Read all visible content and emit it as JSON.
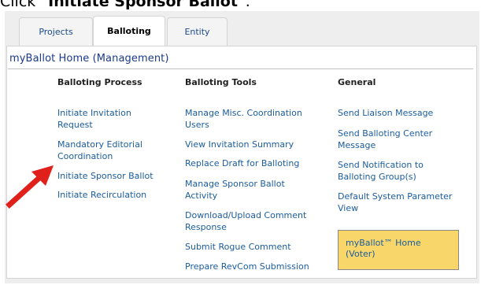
{
  "instruction": {
    "prefix": "Click “",
    "target": "Initiate Sponsor Ballot",
    "suffix": "”."
  },
  "tabs": [
    {
      "label": "Projects",
      "active": false
    },
    {
      "label": "Balloting",
      "active": true
    },
    {
      "label": "Entity",
      "active": false
    }
  ],
  "page_title": "myBallot Home (Management)",
  "columns": {
    "process": {
      "heading": "Balloting Process",
      "links": [
        "Initiate Invitation Request",
        "Mandatory Editorial Coordination",
        "Initiate Sponsor Ballot",
        "Initiate Recirculation"
      ]
    },
    "tools": {
      "heading": "Balloting Tools",
      "links": [
        "Manage Misc. Coordination Users",
        "View Invitation Summary",
        "Replace Draft for Balloting",
        "Manage Sponsor Ballot Activity",
        "Download/Upload Comment Response",
        "Submit Rogue Comment",
        "Prepare RevCom Submission"
      ]
    },
    "general": {
      "heading": "General",
      "links": [
        "Send Liaison Message",
        "Send Balloting Center Message",
        "Send Notification to Balloting Group(s)",
        "Default System Parameter View"
      ]
    }
  },
  "voter_box": {
    "label": "myBallot™ Home (Voter)",
    "color": "#f9d66a"
  },
  "colors": {
    "link": "#1a5c9e",
    "title": "#1a3a8a",
    "arrow": "#e0211b"
  }
}
